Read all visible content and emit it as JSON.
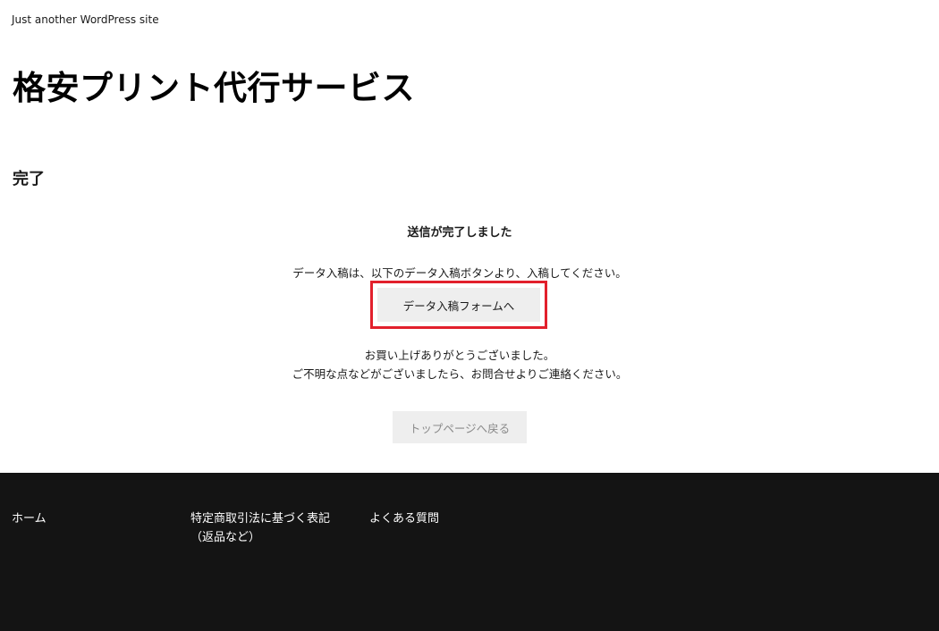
{
  "site": {
    "tagline": "Just another WordPress site",
    "title": "格安プリント代行サービス"
  },
  "page": {
    "title": "完了"
  },
  "main": {
    "complete_heading": "送信が完了しました",
    "instruction": "データ入稿は、以下のデータ入稿ボタンより、入稿してください。",
    "upload_button_label": "データ入稿フォームへ",
    "thanks_line1": "お買い上げありがとうございました。",
    "thanks_line2": "ご不明な点などがございましたら、お問合せよりご連絡ください。",
    "back_button_label": "トップページへ戻る"
  },
  "footer": {
    "links": [
      {
        "label": "ホーム"
      },
      {
        "label": "特定商取引法に基づく表記（返品など）"
      },
      {
        "label": "よくある質問"
      }
    ]
  },
  "colors": {
    "highlight_border": "#e2202c",
    "footer_bg": "#141414",
    "button_bg": "#eeeeee"
  }
}
